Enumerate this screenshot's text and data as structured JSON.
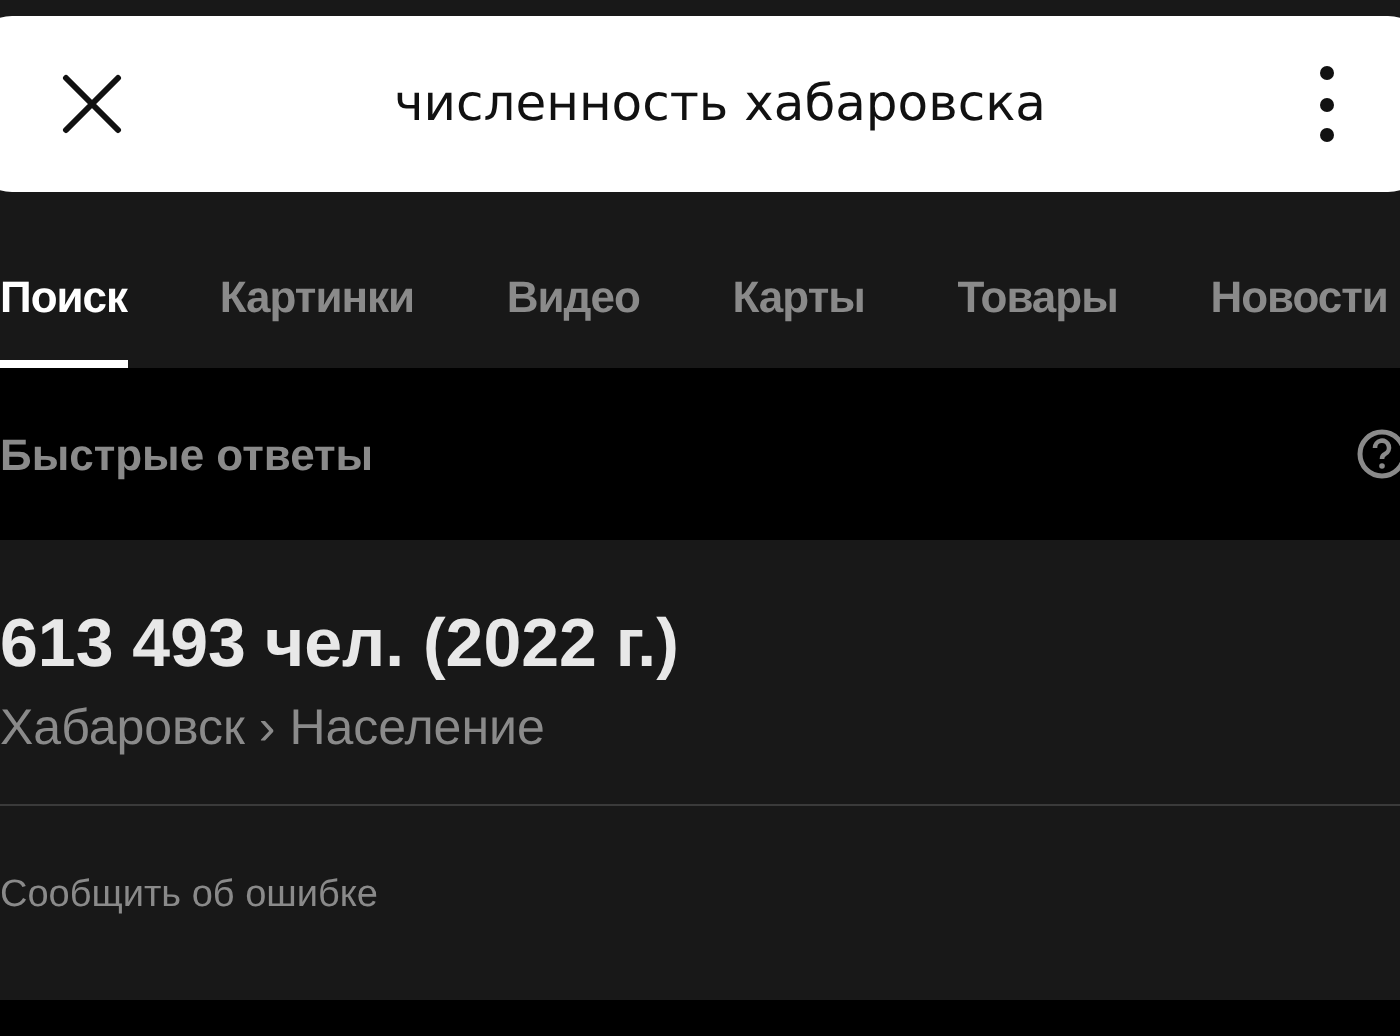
{
  "search": {
    "value": "численность хабаровска"
  },
  "tabs": [
    {
      "label": "Поиск",
      "selected": true
    },
    {
      "label": "Картинки",
      "selected": false
    },
    {
      "label": "Видео",
      "selected": false
    },
    {
      "label": "Карты",
      "selected": false
    },
    {
      "label": "Товары",
      "selected": false
    },
    {
      "label": "Новости",
      "selected": false
    }
  ],
  "section": {
    "title": "Быстрые ответы"
  },
  "answer": {
    "value": "613 493 чел. (2022 г.)",
    "breadcrumb": "Хабаровск › Население",
    "report_link": "Сообщить об ошибке"
  }
}
